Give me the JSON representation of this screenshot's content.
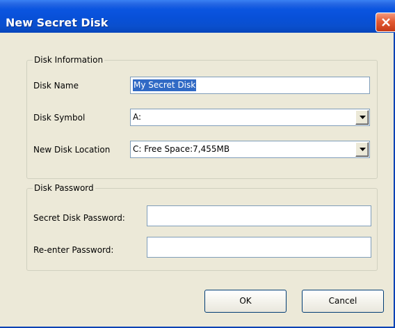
{
  "window": {
    "title": "New Secret Disk"
  },
  "icons": {
    "close": "close-icon",
    "dropdown": "chevron-down-icon"
  },
  "disk_information": {
    "legend": "Disk Information",
    "disk_name_label": "Disk Name",
    "disk_name_value": "My Secret Disk",
    "disk_symbol_label": "Disk Symbol",
    "disk_symbol_value": "A:",
    "location_label": "New Disk Location",
    "location_value": "C: Free Space:7,455MB"
  },
  "disk_password": {
    "legend": "Disk Password",
    "password_label": "Secret Disk Password:",
    "password_value": "",
    "reenter_label": "Re-enter Password:",
    "reenter_value": ""
  },
  "buttons": {
    "ok": "OK",
    "cancel": "Cancel"
  },
  "colors": {
    "title_bar": "#0a55df",
    "close_button": "#e05a30",
    "selection": "#316ac5",
    "dialog_background": "#ece9d8"
  }
}
